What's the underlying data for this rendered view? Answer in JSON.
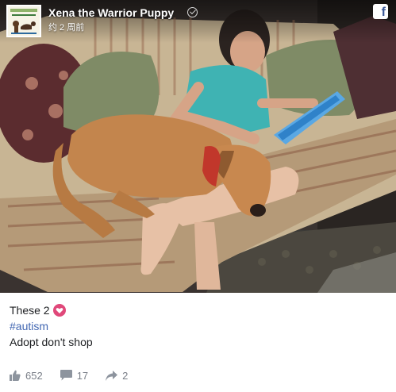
{
  "header": {
    "page_name": "Xena the Warrior Puppy",
    "timestamp": "约 2 周前",
    "icons": [
      "verified-icon",
      "facebook-icon"
    ]
  },
  "post": {
    "caption_line1": "These 2",
    "caption_line2": "#autism",
    "caption_line3": "Adopt don't shop",
    "heart_color": "#e0487a",
    "link_color": "#4267b2"
  },
  "footer": {
    "likes": "652",
    "comments": "17",
    "shares": "2",
    "icons": [
      "like-icon",
      "comment-icon",
      "share-icon"
    ]
  }
}
